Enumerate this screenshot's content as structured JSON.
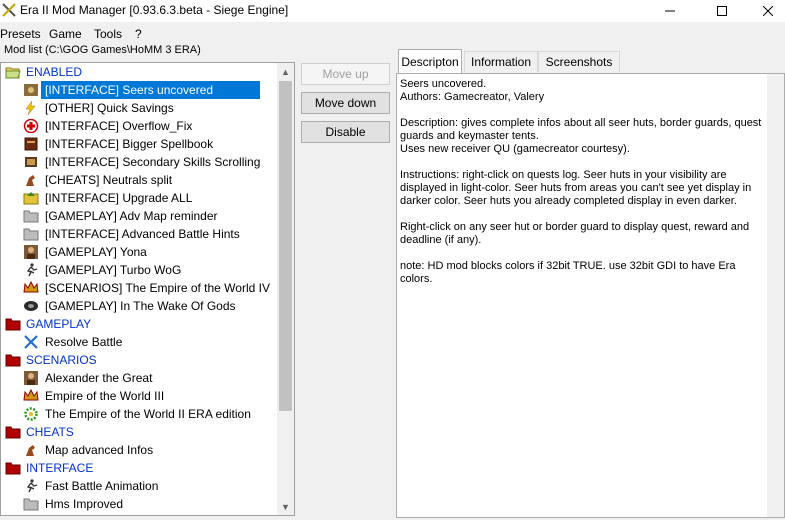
{
  "window": {
    "title": "Era II Mod Manager [0.93.6.3.beta - Siege Engine]"
  },
  "menu": [
    "Presets",
    "Game",
    "Tools",
    "?"
  ],
  "mod_list_label": "Mod list (C:\\GOG Games\\HoMM 3 ERA)",
  "tree": [
    {
      "type": "cat",
      "label": "ENABLED",
      "icon": "folder-open-icon"
    },
    {
      "type": "mod",
      "label": "[INTERFACE] Seers uncovered",
      "icon": "seer-hut-icon",
      "selected": true
    },
    {
      "type": "mod",
      "label": "[OTHER] Quick Savings",
      "icon": "lightning-icon"
    },
    {
      "type": "mod",
      "label": "[INTERFACE] Overflow_Fix",
      "icon": "red-cross-icon"
    },
    {
      "type": "mod",
      "label": "[INTERFACE] Bigger Spellbook",
      "icon": "spellbook-icon"
    },
    {
      "type": "mod",
      "label": "[INTERFACE] Secondary Skills Scrolling",
      "icon": "scroll-icon"
    },
    {
      "type": "mod",
      "label": "[CHEATS] Neutrals split",
      "icon": "creature-icon"
    },
    {
      "type": "mod",
      "label": "[INTERFACE] Upgrade ALL",
      "icon": "upgrade-icon"
    },
    {
      "type": "mod",
      "label": "[GAMEPLAY] Adv Map reminder",
      "icon": "folder-gray-icon"
    },
    {
      "type": "mod",
      "label": "[INTERFACE] Advanced Battle Hints",
      "icon": "folder-gray-icon"
    },
    {
      "type": "mod",
      "label": "[GAMEPLAY] Yona",
      "icon": "portrait-icon"
    },
    {
      "type": "mod",
      "label": "[GAMEPLAY] Turbo WoG",
      "icon": "runner-icon"
    },
    {
      "type": "mod",
      "label": "[SCENARIOS] The Empire of the World IV",
      "icon": "crown-icon"
    },
    {
      "type": "mod",
      "label": "[GAMEPLAY] In The Wake Of Gods",
      "icon": "wog-icon"
    },
    {
      "type": "cat",
      "label": "GAMEPLAY",
      "icon": "folder-red-icon"
    },
    {
      "type": "mod",
      "label": "Resolve Battle",
      "icon": "crossed-swords-icon"
    },
    {
      "type": "cat",
      "label": "SCENARIOS",
      "icon": "folder-red-icon"
    },
    {
      "type": "mod",
      "label": "Alexander the Great",
      "icon": "portrait-icon"
    },
    {
      "type": "mod",
      "label": "Empire of the World III",
      "icon": "crown-icon"
    },
    {
      "type": "mod",
      "label": "The Empire of the World II ERA edition",
      "icon": "gear-green-icon"
    },
    {
      "type": "cat",
      "label": "CHEATS",
      "icon": "folder-red-icon"
    },
    {
      "type": "mod",
      "label": "Map advanced Infos",
      "icon": "creature-icon"
    },
    {
      "type": "cat",
      "label": "INTERFACE",
      "icon": "folder-red-icon"
    },
    {
      "type": "mod",
      "label": "Fast Battle Animation",
      "icon": "runner-icon"
    },
    {
      "type": "mod",
      "label": "Hms Improved",
      "icon": "folder-gray-icon"
    }
  ],
  "buttons": {
    "move_up": "Move up",
    "move_down": "Move down",
    "disable": "Disable"
  },
  "tabs": [
    "Descripton",
    "Information",
    "Screenshots"
  ],
  "description": "Seers uncovered.\nAuthors: Gamecreator, Valery\n\nDescription: gives complete infos about all seer huts, border guards, quest guards and keymaster tents.\nUses new receiver QU (gamecreator courtesy).\n\nInstructions: right-click on quests log. Seer huts in your visibility are displayed in light-color. Seer huts from areas you can't see yet display in darker color. Seer huts you already completed display in even darker.\n\nRight-click on any seer hut or border guard to display quest, reward and deadline (if any).\n\nnote: HD mod blocks colors if 32bit TRUE. use 32bit GDI to have Era colors."
}
